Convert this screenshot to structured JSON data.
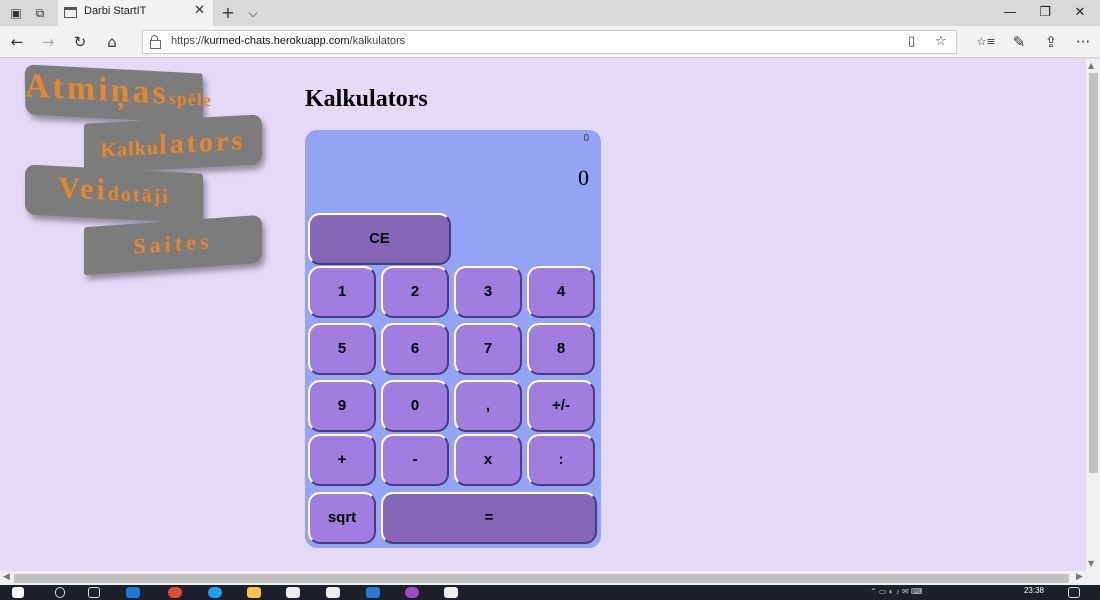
{
  "browser": {
    "tab_title": "Darbi StartIT",
    "url_prefix": "https://",
    "url_host": "kurmed-chats.herokuapp.com",
    "url_path": "/kalkulators",
    "icons": {
      "tab_actions": "tab-actions-icon",
      "set_aside": "set-aside-tabs-icon",
      "new_tab": "+",
      "tab_list": "⌵",
      "close_tab": "✕",
      "back": "←",
      "forward": "→",
      "refresh": "↻",
      "home": "⌂",
      "reading_view": "▯",
      "favorite": "☆",
      "favorites_hub": "☆≡",
      "notes": "✎",
      "share": "⇪",
      "more": "···"
    },
    "window": {
      "minimize": "—",
      "restore": "❐",
      "close": "✕"
    }
  },
  "sidebar": {
    "items": [
      {
        "big": "Atmiņas",
        "small": " spēle"
      },
      {
        "small": "Kalku",
        "big": "lators"
      },
      {
        "big": "Vei",
        "small": "dotāji"
      },
      {
        "label": "Saites"
      }
    ]
  },
  "main": {
    "title": "Kalkulators"
  },
  "calculator": {
    "memory": "0",
    "display": "0",
    "keys": {
      "ce": "CE",
      "k1": "1",
      "k2": "2",
      "k3": "3",
      "k4": "4",
      "k5": "5",
      "k6": "6",
      "k7": "7",
      "k8": "8",
      "k9": "9",
      "k0": "0",
      "comma": ",",
      "negate": "+/-",
      "plus": "+",
      "minus": "-",
      "times": "x",
      "divide": ":",
      "sqrt": "sqrt",
      "equals": "="
    }
  },
  "taskbar": {
    "time": "23:38"
  },
  "colors": {
    "page_bg": "#e4daf8",
    "calc_bg": "#94a4f4",
    "key": "#a27de0",
    "key_dark": "#8566b8",
    "nav_bg": "#7c7c7c",
    "nav_text": "#e8862a"
  }
}
